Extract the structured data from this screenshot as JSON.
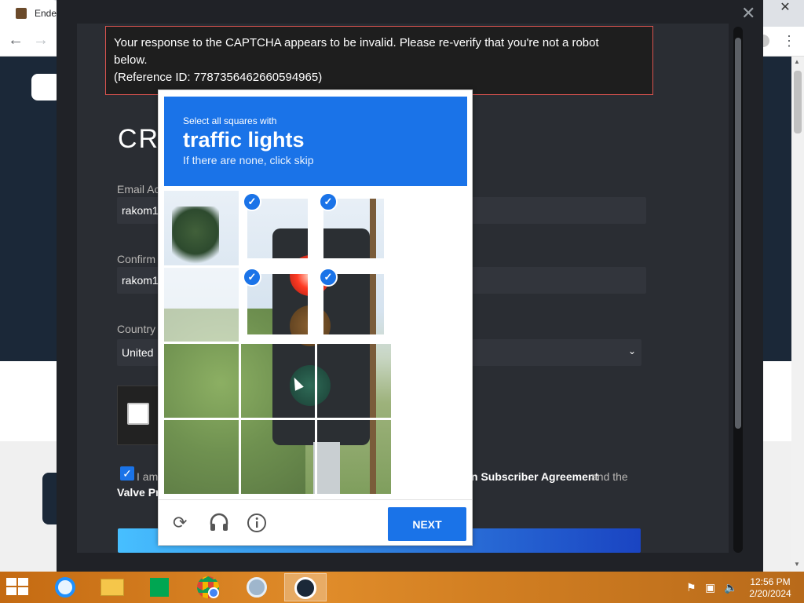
{
  "browser": {
    "tab_title": "Ender",
    "close_glyph": "✕",
    "back_glyph": "←",
    "forward_glyph": "→",
    "menu_glyph": "⋮"
  },
  "modal": {
    "close_glyph": "✕"
  },
  "error": {
    "line1": "Your response to the CAPTCHA appears to be invalid. Please re-verify that you're not a robot",
    "line2": "below.",
    "line3": "(Reference ID: 7787356462660594965)"
  },
  "form": {
    "title": "CRI",
    "email_label": "Email Ac",
    "email_value": "rakom1",
    "confirm_label": "Confirm",
    "confirm_value": "rakom1",
    "country_label": "Country",
    "country_value": "United",
    "agree_prefix": "I am",
    "agree_link1": "n Subscriber Agreement",
    "agree_mid": " and the",
    "agree_line2": "Valve Pr"
  },
  "captcha": {
    "instruction": "Select all squares with",
    "target": "traffic lights",
    "hint": "If there are none, click skip",
    "next_label": "NEXT",
    "reload_icon": "reload-icon",
    "audio_icon": "headphones-icon",
    "info_icon": "info-icon",
    "selected_tiles": [
      1,
      4
    ],
    "check_glyph": "✓"
  },
  "taskbar": {
    "time": "12:56 PM",
    "date": "2/20/2024",
    "apps": [
      "internet-explorer",
      "file-explorer",
      "store",
      "chrome",
      "media-center",
      "steam"
    ],
    "active_app": "steam"
  },
  "colors": {
    "captcha_blue": "#1a73e8",
    "error_border": "#d9534f",
    "steam_dark": "#1b2838"
  }
}
